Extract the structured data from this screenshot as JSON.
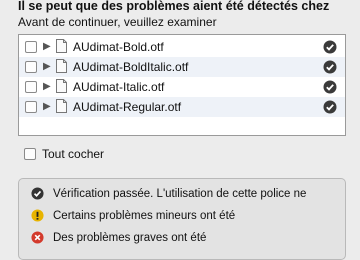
{
  "dialog": {
    "heading": "Il se peut que des problèmes aient été détectés chez",
    "subheading": "Avant de continuer, veuillez examiner"
  },
  "files": [
    {
      "name": "AUdimat-Bold.otf",
      "status_icon": "check-icon"
    },
    {
      "name": "AUdimat-BoldItalic.otf",
      "status_icon": "check-icon"
    },
    {
      "name": "AUdimat-Italic.otf",
      "status_icon": "check-icon"
    },
    {
      "name": "AUdimat-Regular.otf",
      "status_icon": "check-icon"
    }
  ],
  "select_all_label": "Tout cocher",
  "legend": [
    {
      "icon": "check-icon",
      "text": "Vérification passée. L'utilisation de cette police ne",
      "color": "#333333"
    },
    {
      "icon": "warning-icon",
      "text": "Certains problèmes mineurs ont été",
      "color": "#e8b400"
    },
    {
      "icon": "error-icon",
      "text": "Des problèmes graves ont été",
      "color": "#d33a2c"
    }
  ]
}
